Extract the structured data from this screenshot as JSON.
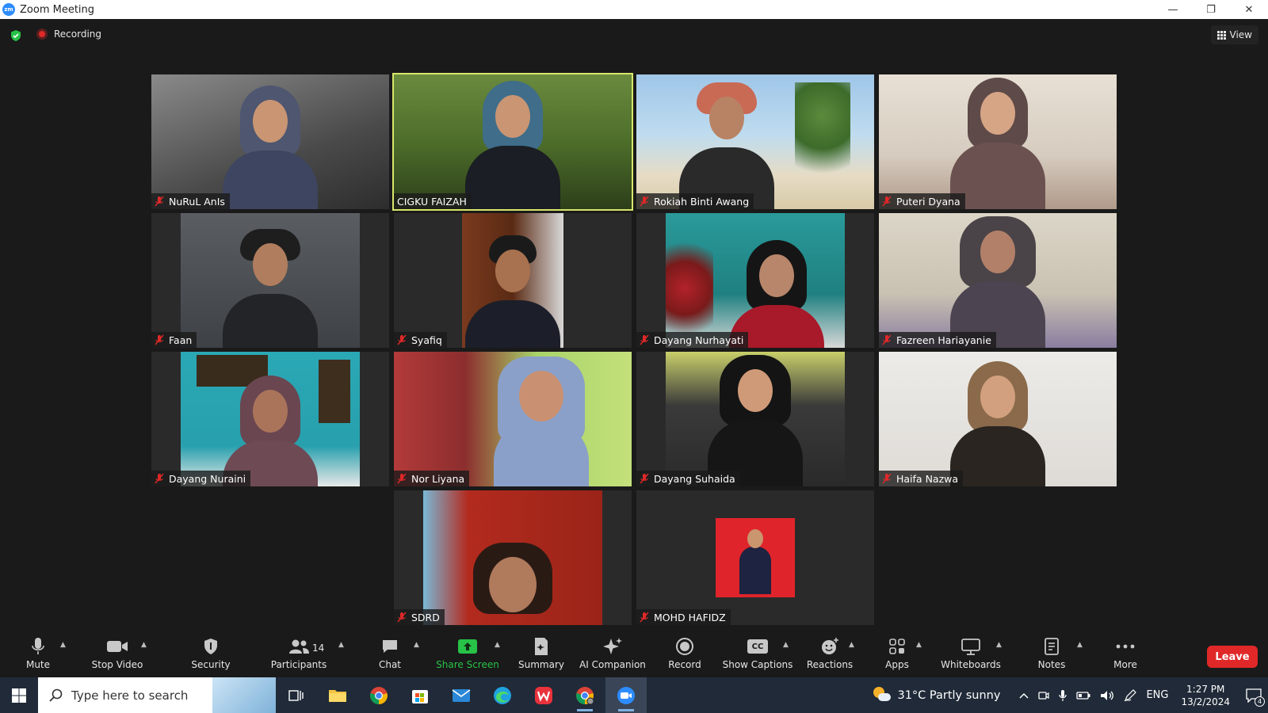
{
  "window": {
    "app_logo_text": "zm",
    "title": "Zoom Meeting",
    "minimize": "—",
    "restore": "❐",
    "close": "✕"
  },
  "meeting": {
    "recording_label": "Recording",
    "view_label": "View"
  },
  "participants_grid": [
    {
      "name": "NuRuL AnIs",
      "muted": true
    },
    {
      "name": "CIGKU FAIZAH",
      "muted": false,
      "active_speaker": true
    },
    {
      "name": "Rokiah Binti Awang",
      "muted": true
    },
    {
      "name": "Puteri Dyana",
      "muted": true
    },
    {
      "name": "Faan",
      "muted": true
    },
    {
      "name": "Syafiq",
      "muted": true
    },
    {
      "name": "Dayang Nurhayati",
      "muted": true
    },
    {
      "name": "Fazreen Hariayanie",
      "muted": true
    },
    {
      "name": "Dayang Nuraini",
      "muted": true
    },
    {
      "name": "Nor Liyana",
      "muted": true
    },
    {
      "name": "Dayang Suhaida",
      "muted": true
    },
    {
      "name": "Haifa Nazwa",
      "muted": true
    },
    {
      "name": "SDRD",
      "muted": true
    },
    {
      "name": "MOHD HAFIDZ",
      "muted": true
    }
  ],
  "toolbar": {
    "mute": "Mute",
    "stop_video": "Stop Video",
    "security": "Security",
    "participants": "Participants",
    "participants_count": "14",
    "chat": "Chat",
    "share_screen": "Share Screen",
    "summary": "Summary",
    "ai_companion": "AI Companion",
    "record": "Record",
    "show_captions": "Show Captions",
    "cc_icon_text": "CC",
    "reactions": "Reactions",
    "apps": "Apps",
    "whiteboards": "Whiteboards",
    "notes": "Notes",
    "more": "More",
    "leave": "Leave"
  },
  "taskbar": {
    "search_placeholder": "Type here to search",
    "weather": "31°C  Partly sunny",
    "language": "ENG",
    "time": "1:27 PM",
    "date": "13/2/2024",
    "notification_count": "4"
  },
  "colors": {
    "meeting_bg": "#1a1a1a",
    "active_speaker_border": "#d8e66a",
    "share_green": "#27c247",
    "leave_red": "#e02828",
    "taskbar_bg": "#202a38"
  }
}
